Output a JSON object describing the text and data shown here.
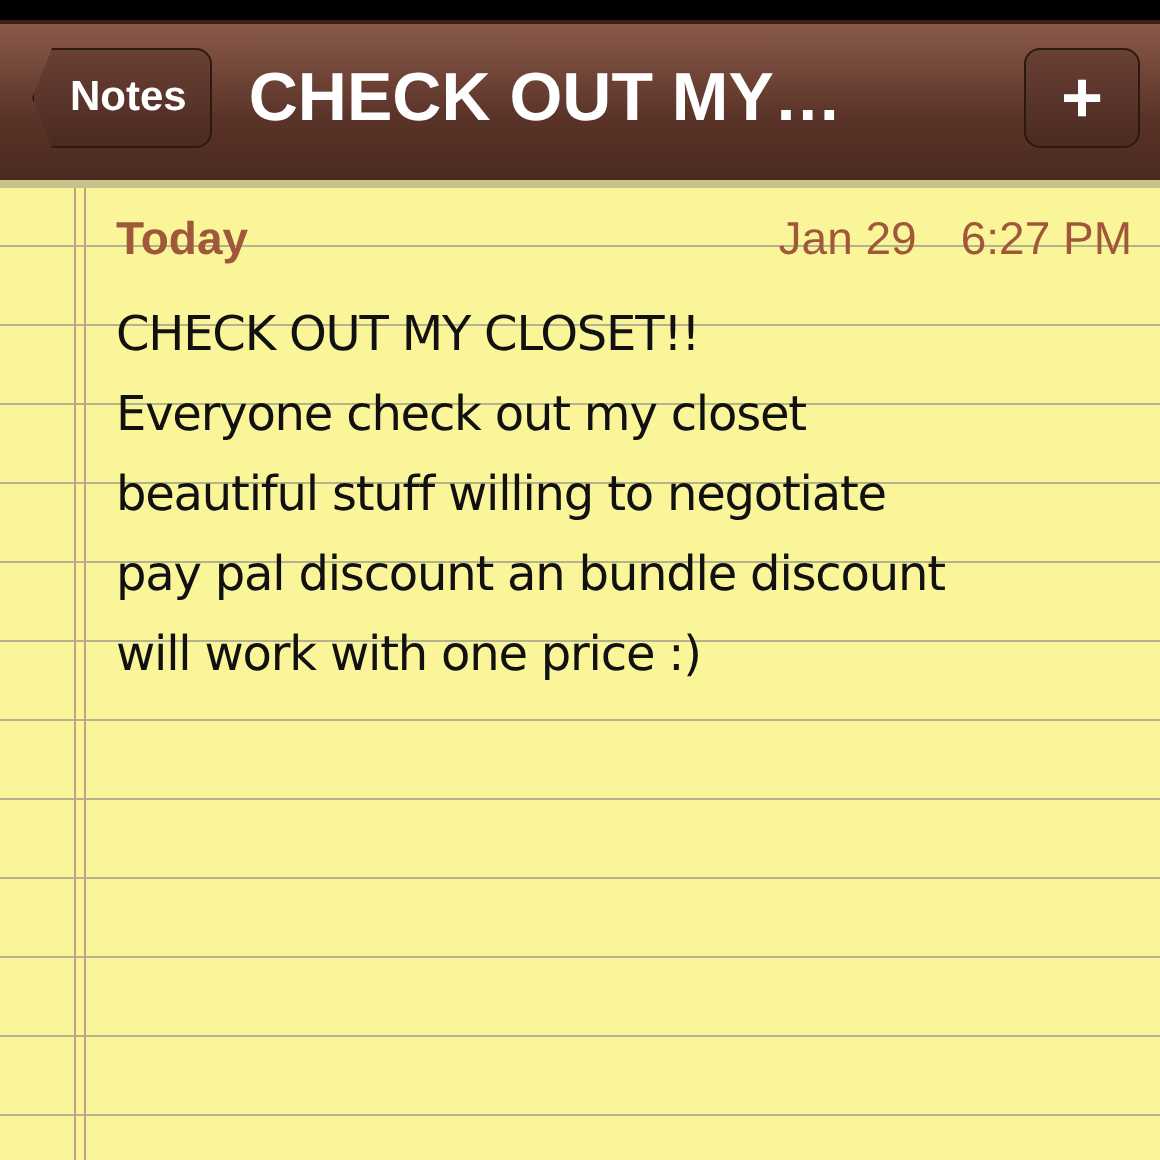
{
  "nav_bar": {
    "back_button": "Notes",
    "title": "CHECK OUT MY…",
    "add_button": "+"
  },
  "note": {
    "day": "Today",
    "date": "Jan 29",
    "time": "6:27 PM",
    "lines": [
      "CHECK OUT MY CLOSET!!",
      "Everyone check out my closet",
      "beautiful stuff willing to negotiate",
      "pay pal discount an bundle discount",
      "will work with one price :)"
    ]
  }
}
